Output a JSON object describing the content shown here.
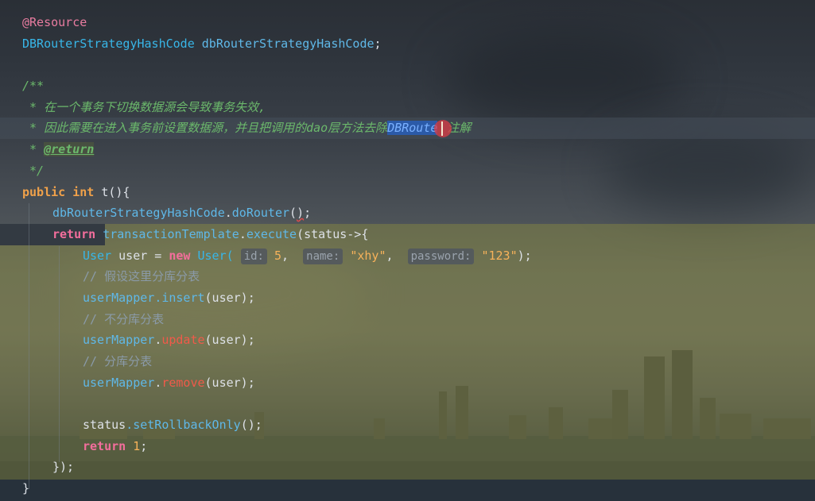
{
  "editor": {
    "lines": {
      "l1": {
        "annotation": "@Resource"
      },
      "l2": {
        "type": "DBRouterStrategyHashCode",
        "field": "dbRouterStrategyHashCode",
        "end": ";"
      },
      "l4": {
        "text": "/**"
      },
      "l5": {
        "text": " * 在一个事务下切换数据源会导致事务失效,"
      },
      "l6": {
        "pre": " * 因此需要在进入事务前设置数据源，并且把调用的dao层方法去除",
        "selected": "DBRoute",
        "post": "注解"
      },
      "l7": {
        "prefix": " * ",
        "tag": "@return"
      },
      "l8": {
        "text": " */"
      },
      "l9": {
        "kw1": "public",
        "kw2": "int",
        "rest": " t(){"
      },
      "l10": {
        "obj": "dbRouterStrategyHashCode",
        "dot": ".",
        "method": "doRouter",
        "paren_open": "(",
        "paren_close": ")",
        "end": ";"
      },
      "l11": {
        "kw": "return",
        "obj": "transactionTemplate",
        "dot": ".",
        "method": "execute",
        "rest": "(status->{"
      },
      "l12": {
        "type": "User",
        "var": " user = ",
        "kw": "new",
        "ctor": " User(",
        "hint_id": "id:",
        "id_val": "5",
        "hint_name": "name:",
        "name_val": "\"xhy\"",
        "hint_password": "password:",
        "password_val": "\"123\"",
        "end": ");"
      },
      "l13": {
        "text": "// 假设这里分库分表"
      },
      "l14": {
        "obj": "userMapper",
        "method": ".insert",
        "args": "(user);"
      },
      "l15": {
        "text": "// 不分库分表"
      },
      "l16": {
        "obj": "userMapper",
        "dot": ".",
        "method": "update",
        "args": "(user);"
      },
      "l17": {
        "text": "// 分库分表"
      },
      "l18": {
        "obj": "userMapper",
        "dot": ".",
        "method": "remove",
        "args": "(user);"
      },
      "l20": {
        "obj": "status",
        "method": ".setRollbackOnly",
        "args": "();"
      },
      "l21": {
        "kw": "return",
        "num": "1",
        "end": ";"
      },
      "l22": {
        "text": "});"
      },
      "l23": {
        "text": "}"
      }
    }
  },
  "colors": {
    "keyword": "#f0a14a",
    "type": "#38b6e8",
    "comment": "#6bb86b",
    "string": "#f7b25a",
    "annotation": "#e87ca0",
    "selection": "#2b5aa8"
  }
}
